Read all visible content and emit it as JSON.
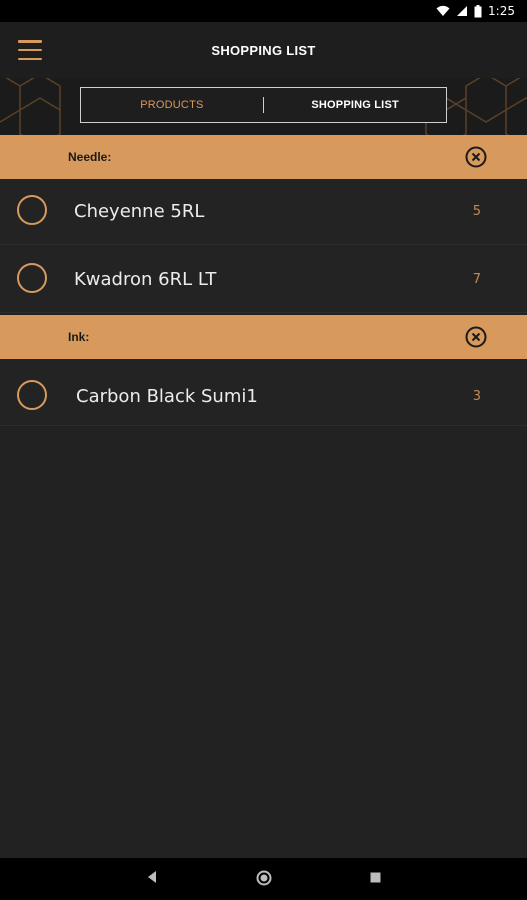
{
  "status_bar": {
    "time": "1:25"
  },
  "app_bar": {
    "title": "SHOPPING LIST"
  },
  "tabs": [
    {
      "label": "PRODUCTS",
      "active": false
    },
    {
      "label": "SHOPPING LIST",
      "active": true
    }
  ],
  "categories": [
    {
      "name": "Needle:",
      "items": [
        {
          "name": "Cheyenne 5RL",
          "qty": "5"
        },
        {
          "name": "Kwadron 6RL LT",
          "qty": "7"
        }
      ]
    },
    {
      "name": "Ink:",
      "items": [
        {
          "name": "Carbon Black Sumi1",
          "qty": "3"
        }
      ]
    }
  ],
  "colors": {
    "accent": "#d79a5c",
    "background": "#222222",
    "app_bar": "#1e1e1e"
  },
  "icons": [
    "menu-icon",
    "wifi-icon",
    "signal-icon",
    "battery-icon",
    "close-circle-icon",
    "back-icon",
    "home-icon",
    "recents-icon"
  ]
}
